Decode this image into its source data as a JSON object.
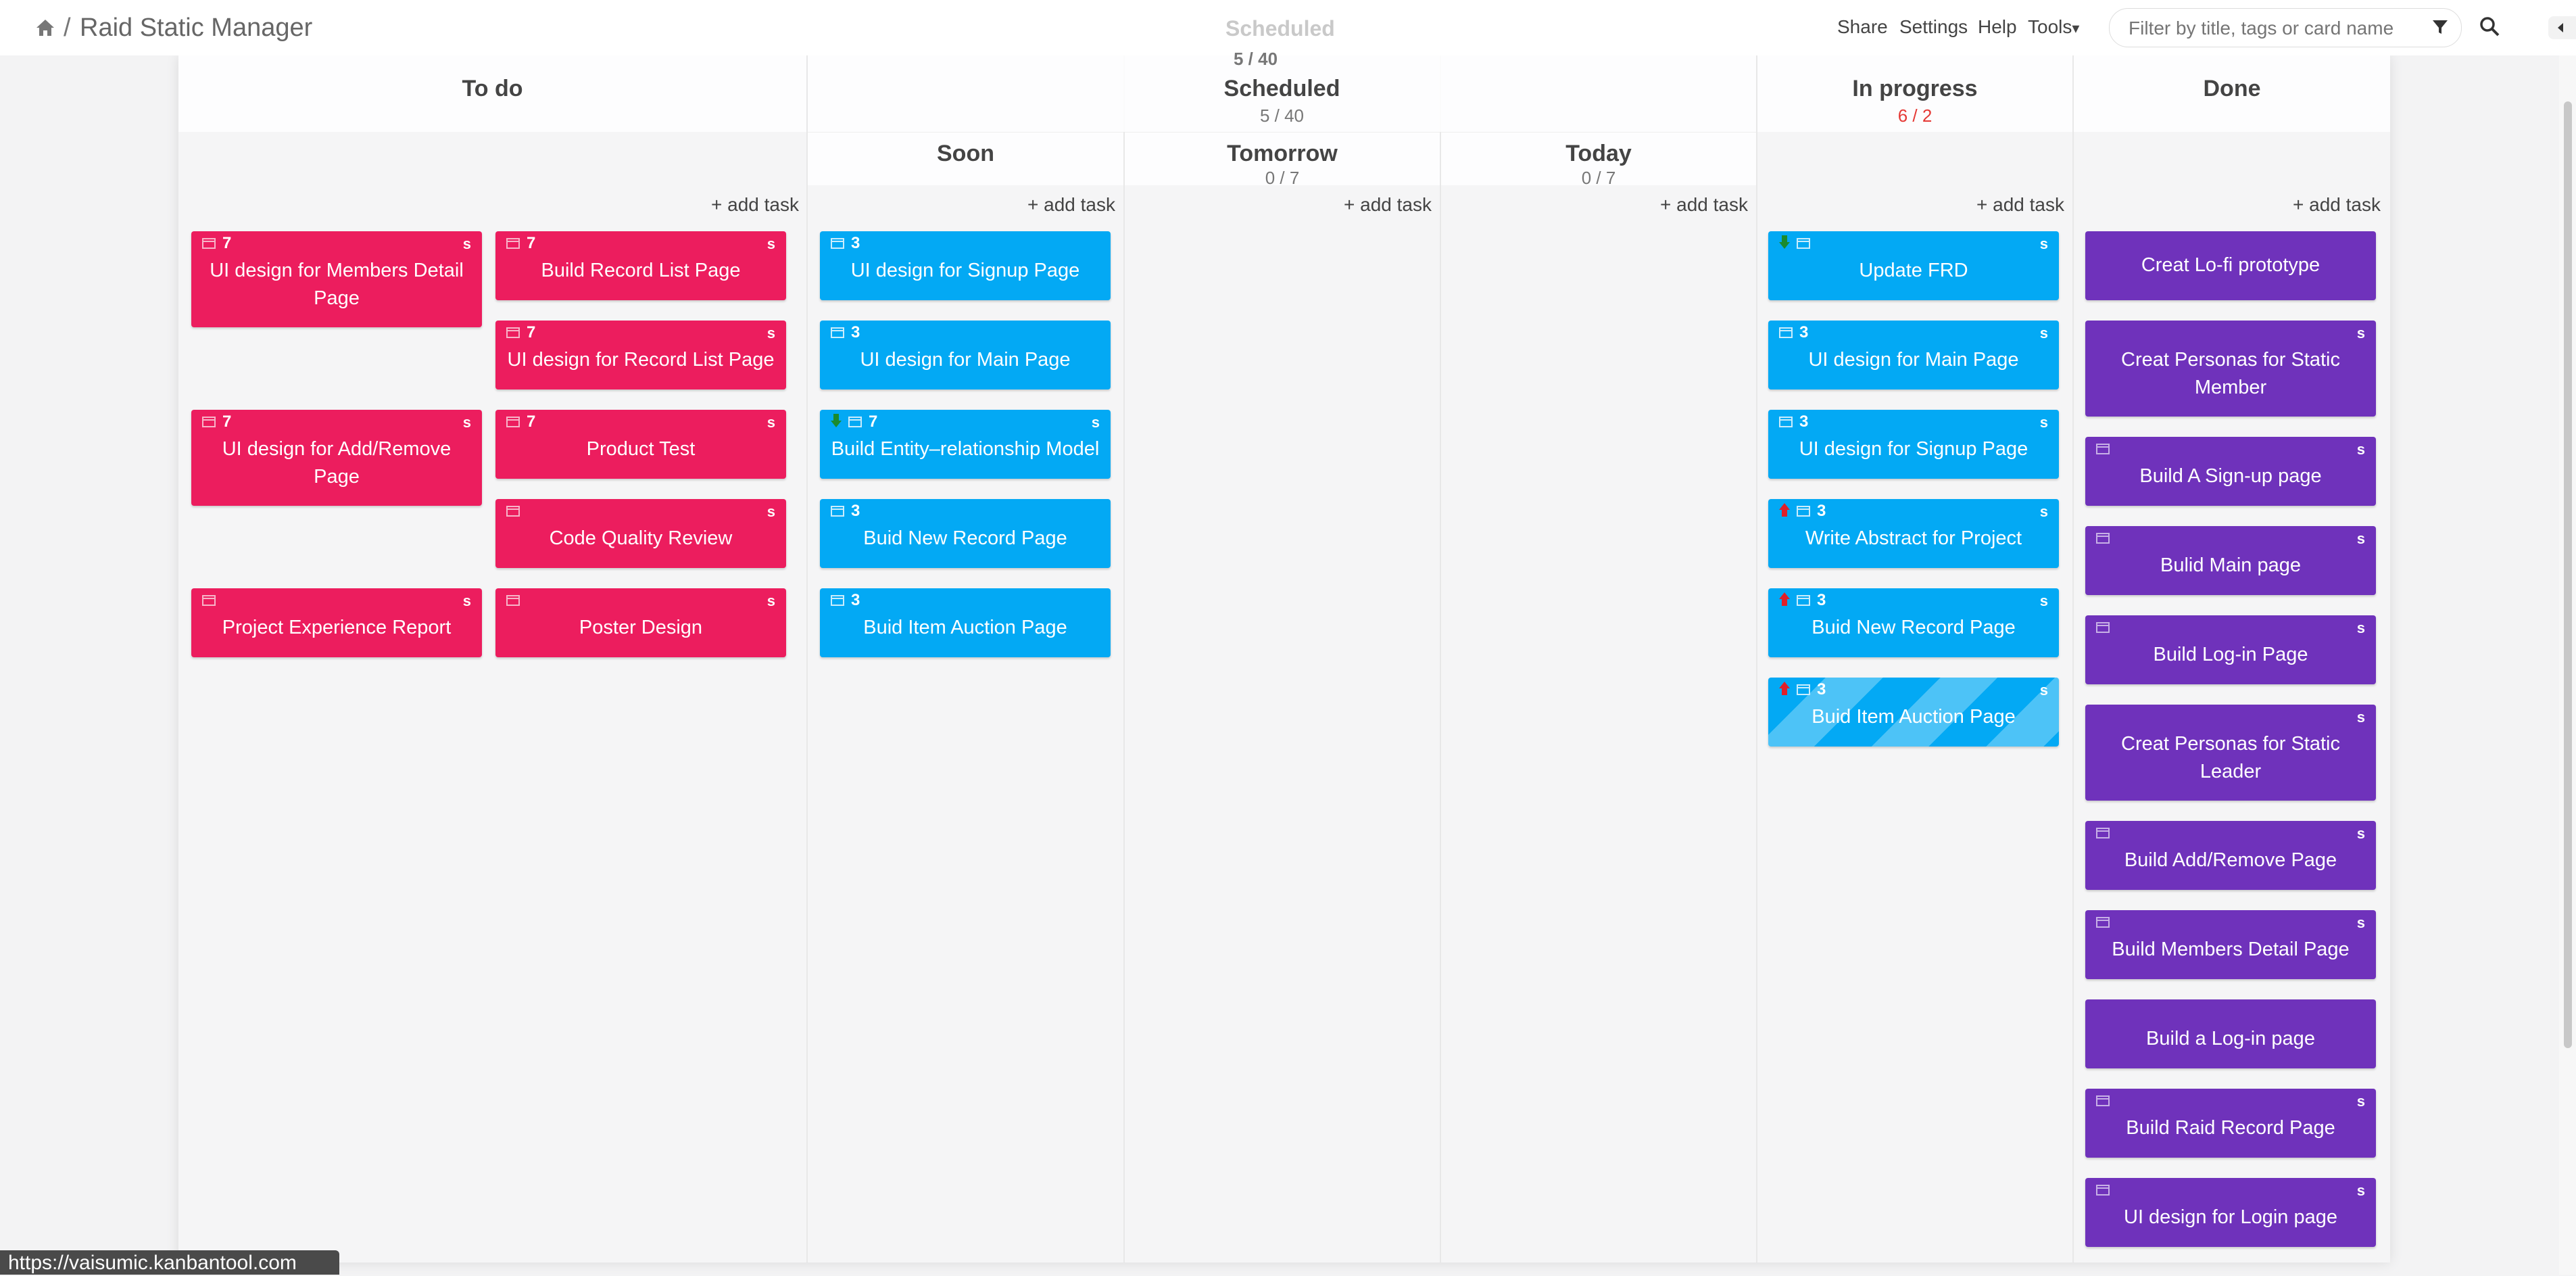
{
  "app": {
    "title": "Raid Static Manager",
    "breadcrumb_sep": "/"
  },
  "menu": {
    "share": "Share",
    "settings": "Settings",
    "help": "Help",
    "tools": "Tools",
    "tools_caret": "▾"
  },
  "filter": {
    "placeholder": "Filter by title, tags or card name"
  },
  "ghost_header": {
    "title": "Scheduled",
    "count": "5 / 40"
  },
  "columns": {
    "todo": {
      "name": "To do",
      "add": "+ add task"
    },
    "scheduled": {
      "name": "Scheduled",
      "count": "5 / 40",
      "soon": {
        "name": "Soon",
        "add": "+ add task"
      },
      "tomorrow": {
        "name": "Tomorrow",
        "count": "0 / 7",
        "add": "+ add task"
      },
      "today": {
        "name": "Today",
        "count": "0 / 7",
        "add": "+ add task"
      }
    },
    "inprogress": {
      "name": "In progress",
      "count": "6 / 2",
      "add": "+ add task"
    },
    "done": {
      "name": "Done",
      "add": "+ add task"
    }
  },
  "cards": {
    "todo": [
      {
        "title": "UI design for Members Detail Page",
        "num": "7",
        "size": "s"
      },
      {
        "title": "Build Record List Page",
        "num": "7",
        "size": "s"
      },
      {
        "title": "UI design for Record List Page",
        "num": "7",
        "size": "s"
      },
      {
        "title": "UI design for Add/Remove Page",
        "num": "7",
        "size": "s"
      },
      {
        "title": "Product Test",
        "num": "7",
        "size": "s"
      },
      {
        "title": "Code Quality Review",
        "num": "",
        "size": "s"
      },
      {
        "title": "Project Experience Report",
        "num": "",
        "size": "s"
      },
      {
        "title": "Poster Design",
        "num": "",
        "size": "s"
      }
    ],
    "soon": [
      {
        "title": "UI design for Signup Page",
        "num": "3",
        "size": ""
      },
      {
        "title": "UI design for Main Page",
        "num": "3",
        "size": ""
      },
      {
        "title": "Build Entity–relationship Model",
        "num": "7",
        "size": "s",
        "arrow": "down"
      },
      {
        "title": "Buid New Record Page",
        "num": "3",
        "size": ""
      },
      {
        "title": "Buid Item Auction Page",
        "num": "3",
        "size": ""
      }
    ],
    "inprogress": [
      {
        "title": "Update FRD",
        "num": "",
        "size": "s",
        "arrow": "down"
      },
      {
        "title": "UI design for Main Page",
        "num": "3",
        "size": "s"
      },
      {
        "title": "UI design for Signup Page",
        "num": "3",
        "size": "s"
      },
      {
        "title": "Write Abstract for Project",
        "num": "3",
        "size": "s",
        "arrow": "up"
      },
      {
        "title": "Buid New Record Page",
        "num": "3",
        "size": "s",
        "arrow": "up"
      },
      {
        "title": "Buid Item Auction Page",
        "num": "3",
        "size": "s",
        "arrow": "up"
      }
    ],
    "done": [
      {
        "title": "Creat Lo-fi prototype",
        "size": ""
      },
      {
        "title": "Creat Personas for Static Member",
        "size": "s"
      },
      {
        "title": "Build A Sign-up page",
        "size": "s"
      },
      {
        "title": "Bulid Main page",
        "size": "s"
      },
      {
        "title": "Build Log-in Page",
        "size": "s"
      },
      {
        "title": "Creat Personas for Static Leader",
        "size": "s"
      },
      {
        "title": "Build Add/Remove Page",
        "size": "s"
      },
      {
        "title": "Build Members Detail Page",
        "size": "s"
      },
      {
        "title": "Build a Log-in page",
        "size": ""
      },
      {
        "title": "Build Raid Record Page",
        "size": "s"
      },
      {
        "title": "UI design for Login page",
        "size": "s"
      }
    ]
  },
  "status": {
    "url": "https://vaisumic.kanbantool.com"
  },
  "colors": {
    "red": "#ec1d5e",
    "blue": "#03a9f4",
    "purple": "#6f32bb",
    "overcount": "#e53935"
  }
}
